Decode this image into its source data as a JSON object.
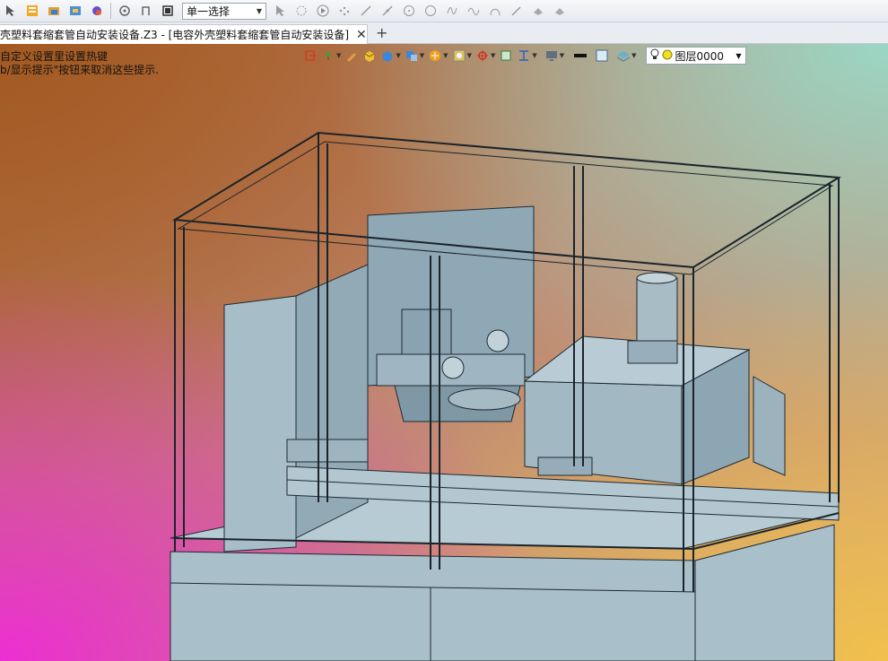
{
  "toolbar": {
    "icons": [
      "cursor-icon",
      "list-icon",
      "folder-icon",
      "import-icon",
      "export-icon",
      "rotate-icon",
      "curve-icon",
      "stop-icon",
      "select-mode",
      "pointer-icon",
      "lasso-icon",
      "play-icon",
      "snap-icon",
      "line-icon",
      "arc-icon",
      "circle-icon",
      "circle2-icon",
      "spline-icon",
      "wave-icon",
      "arch-icon",
      "pen-icon",
      "hat-icon",
      "hat2-icon"
    ],
    "select_mode_value": "单一选择"
  },
  "tabs": [
    {
      "title": "壳塑料套缩套管自动安装设备.Z3 - [电容外壳塑料套缩套管自动安装设备]",
      "active": true
    }
  ],
  "tab_add_label": "+",
  "viewport": {
    "hint_line1": "自定义设置里设置热键",
    "hint_line2": "b/显示提示\"按钮来取消这些提示.",
    "layer_label": "图层0000"
  },
  "colors": {
    "model_fill": "#9fb8c4",
    "model_stroke": "#1e2a33",
    "bg_topleft": "#a35a22",
    "bg_bottomleft": "#ec2fd2",
    "bg_bottomright": "#f2c04c",
    "bg_topright": "#9ad6c4"
  }
}
